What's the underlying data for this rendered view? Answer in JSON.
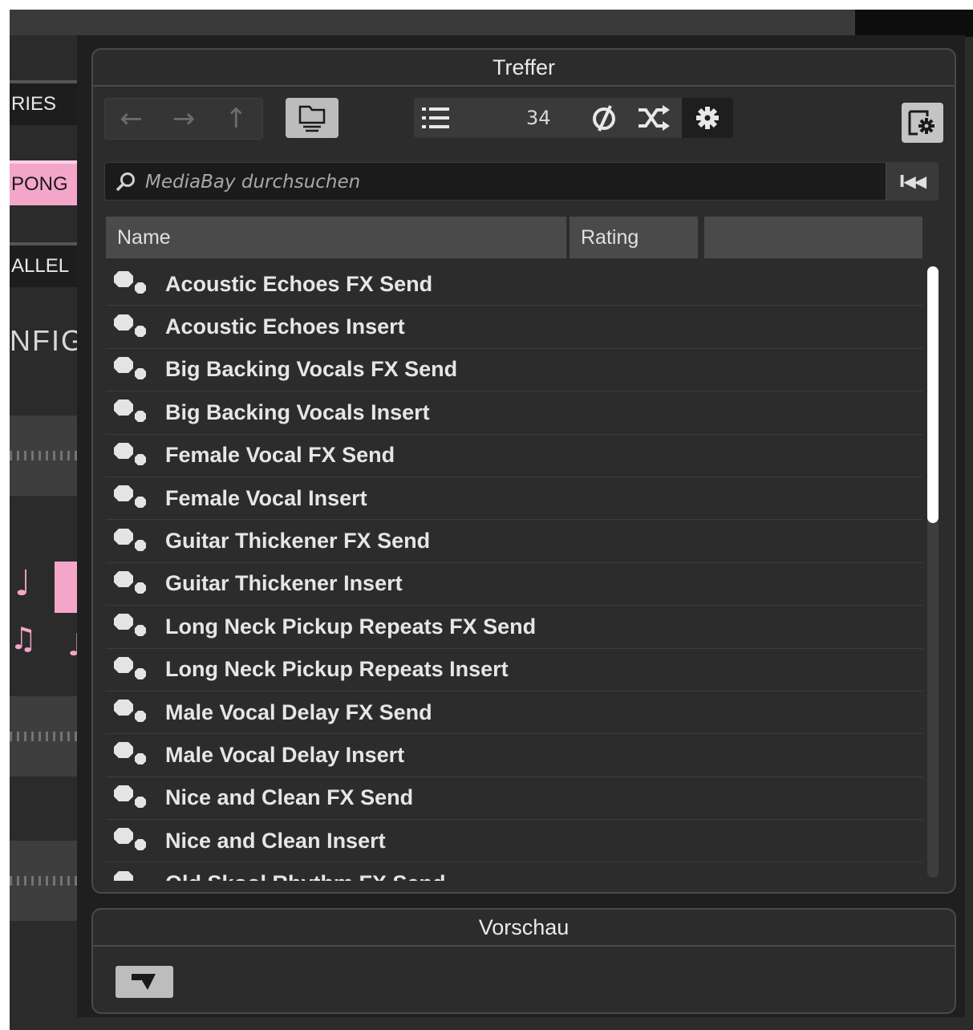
{
  "background": {
    "side_buttons": [
      "RIES",
      "PONG",
      "ALLEL"
    ],
    "side_label": "NFIG"
  },
  "results_panel": {
    "title": "Treffer",
    "result_count": "34",
    "search": {
      "placeholder": "MediaBay durchsuchen",
      "value": ""
    },
    "columns": [
      "Name",
      "Rating",
      ""
    ],
    "rows": [
      "Acoustic Echoes FX Send",
      "Acoustic Echoes Insert",
      "Big Backing Vocals FX Send",
      "Big Backing Vocals Insert",
      "Female Vocal FX Send",
      "Female Vocal Insert",
      "Guitar Thickener FX Send",
      "Guitar Thickener Insert",
      "Long Neck Pickup Repeats FX Send",
      "Long Neck Pickup Repeats Insert",
      "Male Vocal Delay FX Send",
      "Male Vocal Delay Insert",
      "Nice and Clean FX Send",
      "Nice and Clean Insert",
      "Old Skool Rhythm FX Send"
    ],
    "scroll_position": 0,
    "scroll_visible_fraction": 0.42
  },
  "preview_panel": {
    "title": "Vorschau"
  },
  "colors": {
    "accent_pink": "#f4a6c8",
    "panel_bg": "#2c2c2c",
    "header_bg": "#4a4a4a"
  },
  "icons": {
    "back": "arrow-left-icon",
    "forward": "arrow-right-icon",
    "up": "arrow-up-icon",
    "folder": "folder-tree-icon",
    "list": "list-view-icon",
    "refresh": "refresh-icon",
    "shuffle": "shuffle-icon",
    "gear": "gear-icon",
    "settings": "panel-settings-icon",
    "search": "search-icon",
    "reset": "reset-filter-icon",
    "row": "preset-icon",
    "preview": "preview-toggle-icon"
  }
}
